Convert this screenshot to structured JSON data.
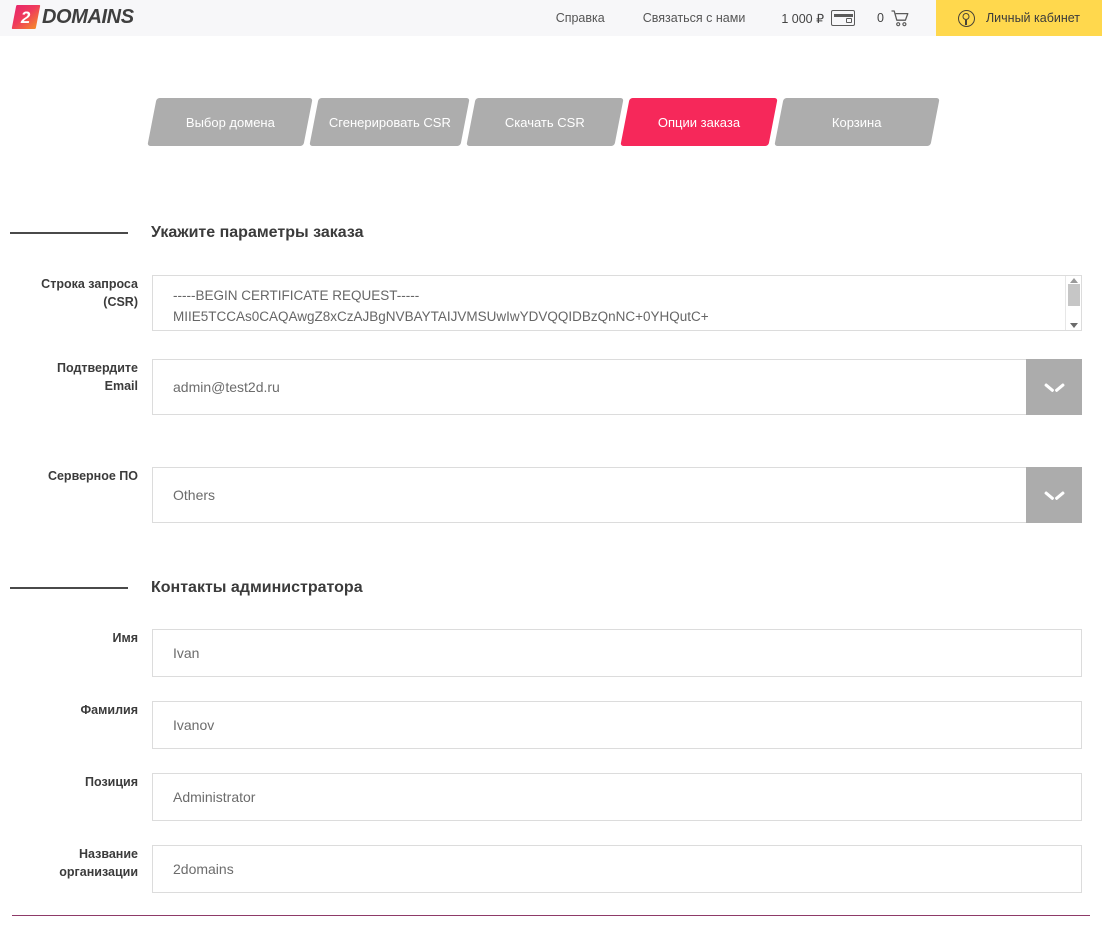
{
  "header": {
    "logo": {
      "badge": "2",
      "word": "DOMAINS"
    },
    "links": [
      {
        "label": "Справка",
        "icon": "help-link"
      },
      {
        "label": "Связаться с нами",
        "icon": "contact-link"
      }
    ],
    "balance": {
      "amount": "1 000 ₽",
      "icon": "credit-card-icon"
    },
    "cart": {
      "count": "0",
      "icon": "shopping-cart-icon"
    },
    "account": {
      "label": "Личный кабинет",
      "icon": "user-circle-icon",
      "bg": "#ffd84d"
    }
  },
  "steps": {
    "active_index": 3,
    "items": [
      {
        "label": "Выбор домена"
      },
      {
        "label": "Сгенерировать CSR"
      },
      {
        "label": "Скачать CSR"
      },
      {
        "label": "Опции заказа"
      },
      {
        "label": "Корзина"
      }
    ],
    "colors": {
      "inactive": "#adadad",
      "active": "#f6285a"
    }
  },
  "sections": {
    "order": {
      "title": "Укажите параметры заказа"
    },
    "contacts": {
      "title": "Контакты администратора"
    }
  },
  "form": {
    "csr": {
      "label_line1": "Строка запроса",
      "label_line2": "(CSR)",
      "line1": "-----BEGIN CERTIFICATE REQUEST-----",
      "line2": "MIIE5TCCAs0CAQAwgZ8xCzAJBgNVBAYTAIJVMSUwIwYDVQQIDBzQnNC+0YHQutC+"
    },
    "email": {
      "label_line1": "Подтвердите",
      "label_line2": "Email",
      "value": "admin@test2d.ru"
    },
    "software": {
      "label": "Серверное ПО",
      "value": "Others"
    },
    "first_name": {
      "label": "Имя",
      "value": "Ivan"
    },
    "last_name": {
      "label": "Фамилия",
      "value": "Ivanov"
    },
    "position": {
      "label": "Позиция",
      "value": "Administrator"
    },
    "organization": {
      "label_line1": "Название",
      "label_line2": "организации",
      "value": "2domains"
    }
  },
  "colors": {
    "accent_pink": "#f6285a",
    "accent_yellow": "#ffd84d",
    "bottom_rule": "#8e3a68",
    "header_bg": "#f7f7f9"
  }
}
